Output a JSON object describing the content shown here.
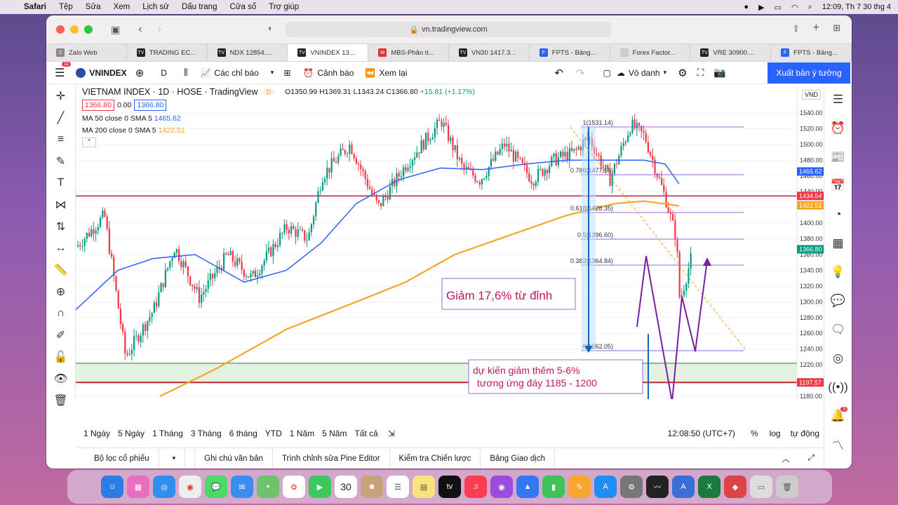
{
  "menubar": {
    "app": "Safari",
    "items": [
      "Tệp",
      "Sửa",
      "Xem",
      "Lịch sử",
      "Dấu trang",
      "Cửa sổ",
      "Trợ giúp"
    ],
    "datetime": "12:09, Th 7 30 thg 4"
  },
  "browser": {
    "url": "vn.tradingview.com",
    "tabs": [
      "Zalo Web",
      "TRADING EC...",
      "NDX 12854....",
      "VNINDEX 13...",
      "MBS-Phân tí...",
      "VN30 1417.3...",
      "FPTS - Bảng...",
      "Forex Factor...",
      "VRE 30900....",
      "FPTS - Bảng..."
    ],
    "active_tab": 3
  },
  "toolbar": {
    "badge": "11",
    "symbol": "VNINDEX",
    "interval": "D",
    "indicators": "Các chỉ báo",
    "alert": "Cảnh báo",
    "replay": "Xem lại",
    "unnamed": "Vô danh",
    "publish": "Xuất bản ý tưởng"
  },
  "legend": {
    "title": "VIETNAM INDEX · 1D · HOSE · TradingView",
    "flag": "D",
    "o": "O1350.99",
    "h": "H1369.31",
    "l": "L1343.24",
    "c": "C1366.80",
    "chg": "+15.81 (+1.17%)",
    "bid": "1366.80",
    "spread": "0.00",
    "ask": "1366.80",
    "ma50_label": "MA 50 close 0 SMA 5",
    "ma50_val": "1465.62",
    "ma200_label": "MA 200 close 0 SMA 5",
    "ma200_val": "1422.51"
  },
  "chart_data": {
    "type": "candlestick",
    "currency": "VND",
    "y_ticks": [
      1540,
      1520,
      1500,
      1480,
      1460,
      1440,
      1420,
      1400,
      1380,
      1360,
      1340,
      1320,
      1300,
      1280,
      1260,
      1240,
      1220,
      1200,
      1180
    ],
    "x_ticks": [
      "Tháng 7",
      "Tháng Tám",
      "Tháng 9",
      "Tháng 10",
      "Tháng 11",
      "Tháng Mười hai",
      "2022",
      "Tháng Hai",
      "7",
      "Tháng 4",
      "Tháng Năm",
      "Tháng 6",
      "Tháng 7"
    ],
    "price_labels": [
      {
        "v": "1465.62",
        "c": "#2962ff"
      },
      {
        "v": "1434.54",
        "c": "#f23645"
      },
      {
        "v": "1422.51",
        "c": "#f5a623"
      },
      {
        "v": "1366.80",
        "c": "#089981"
      },
      {
        "v": "1197.57",
        "c": "#f23645"
      }
    ],
    "fib": [
      {
        "t": "1(1531.14)",
        "y": 159
      },
      {
        "t": "0.786(1477.56)",
        "y": 227
      },
      {
        "t": "0.618(1428.35)",
        "y": 281
      },
      {
        "t": "0.5(1396.60)",
        "y": 319
      },
      {
        "t": "0.382(1364.84)",
        "y": 356
      },
      {
        "t": "0(1262.05)",
        "y": 478
      }
    ],
    "note1": "Giảm 17,6% từ đỉnh",
    "note2a": "dự kiến giảm thêm 5-6%",
    "note2b": "tương ứng đáy 1185 - 1200"
  },
  "periods": [
    "1 Ngày",
    "5 Ngày",
    "1 Tháng",
    "3 Tháng",
    "6 tháng",
    "YTD",
    "1 Năm",
    "5 Năm",
    "Tất cả"
  ],
  "time": "12:08:50 (UTC+7)",
  "pct": "%",
  "log": "log",
  "auto": "tự động",
  "bottom": [
    "Bộ lọc cổ phiếu",
    "Ghi chú văn bản",
    "Trình chỉnh sửa Pine Editor",
    "Kiểm tra Chiến lược",
    "Bảng Giao dịch"
  ],
  "alert_badge": "3"
}
